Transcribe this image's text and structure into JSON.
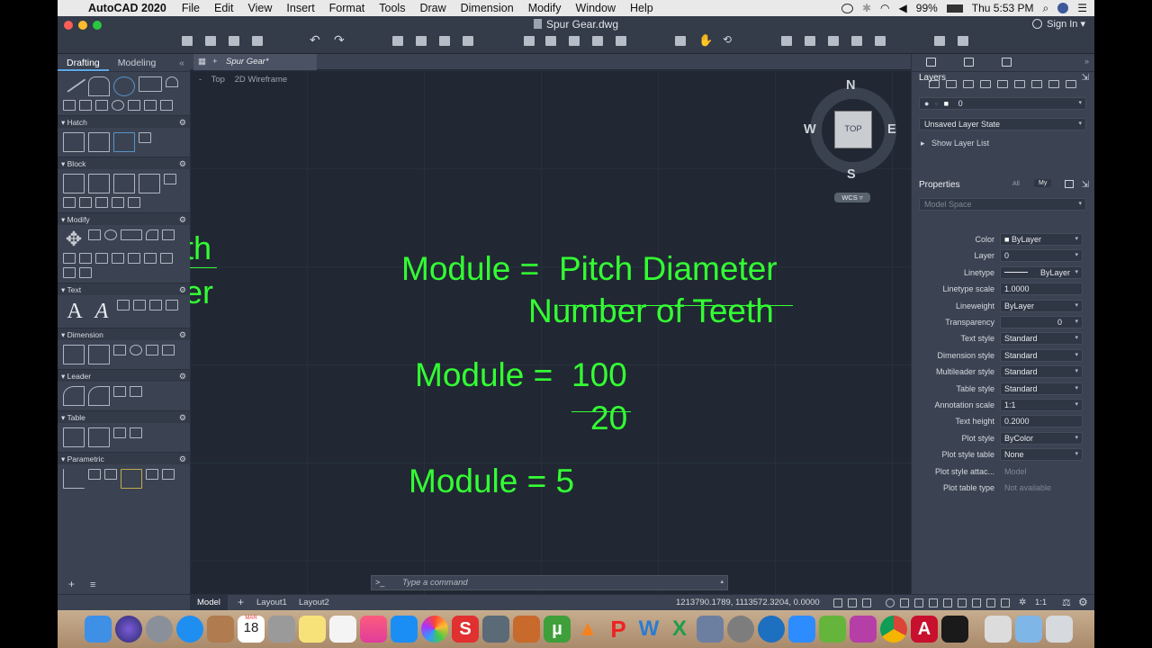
{
  "menubar": {
    "app_name": "AutoCAD 2020",
    "items": [
      "File",
      "Edit",
      "View",
      "Insert",
      "Format",
      "Tools",
      "Draw",
      "Dimension",
      "Modify",
      "Window",
      "Help"
    ],
    "battery": "99%",
    "clock": "Thu 5:53 PM"
  },
  "window": {
    "title": "Spur Gear.dwg",
    "sign_in": "Sign In"
  },
  "left_palette": {
    "tabs": [
      "Drafting",
      "Modeling"
    ],
    "sections": [
      "Hatch",
      "Block",
      "Modify",
      "Text",
      "Dimension",
      "Leader",
      "Table",
      "Parametric"
    ]
  },
  "file_tab": {
    "label": "Spur Gear*"
  },
  "viewport": {
    "view": "Top",
    "visual_style": "2D Wireframe"
  },
  "viewcube": {
    "north": "N",
    "south": "S",
    "east": "E",
    "west": "W",
    "face": "TOP",
    "ucs": "WCS"
  },
  "drawing": {
    "partial_right_1": "th",
    "partial_right_2": "er",
    "eq1_lhs": "Module =",
    "eq1_num": "Pitch Diameter",
    "eq1_den": "Number of Teeth",
    "eq2_lhs": "Module =",
    "eq2_num": "100",
    "eq2_den": "20",
    "eq3": "Module = 5"
  },
  "command_line": {
    "prompt": ">_",
    "placeholder": "Type a command"
  },
  "bottom_tabs": [
    "Model",
    "Layout1",
    "Layout2"
  ],
  "coordinates": "1213790.1789, 1113572.3204, 0.0000",
  "annotation_scale_status": "1:1",
  "layers_panel": {
    "title": "Layers",
    "current_layer": "0",
    "layer_state": "Unsaved Layer State",
    "show_layer_list": "Show Layer List"
  },
  "properties_panel": {
    "title": "Properties",
    "filter_all": "All",
    "filter_my": "My",
    "space": "Model Space",
    "rows": [
      {
        "label": "Color",
        "value": "ByLayer"
      },
      {
        "label": "Layer",
        "value": "0"
      },
      {
        "label": "Linetype",
        "value": "ByLayer"
      },
      {
        "label": "Linetype scale",
        "value": "1.0000"
      },
      {
        "label": "Lineweight",
        "value": "ByLayer"
      },
      {
        "label": "Transparency",
        "value": "0"
      },
      {
        "label": "Text style",
        "value": "Standard"
      },
      {
        "label": "Dimension style",
        "value": "Standard"
      },
      {
        "label": "Multileader style",
        "value": "Standard"
      },
      {
        "label": "Table style",
        "value": "Standard"
      },
      {
        "label": "Annotation scale",
        "value": "1:1"
      },
      {
        "label": "Text height",
        "value": "0.2000"
      },
      {
        "label": "Plot style",
        "value": "ByColor"
      },
      {
        "label": "Plot style table",
        "value": "None"
      },
      {
        "label": "Plot style attac...",
        "value": "Model"
      },
      {
        "label": "Plot table type",
        "value": "Not available"
      }
    ]
  },
  "dock": {
    "calendar_month": "MAR",
    "calendar_day": "18"
  },
  "colors": {
    "drawing_text": "#33ff33",
    "canvas": "#212833",
    "panel": "#3b4352"
  }
}
